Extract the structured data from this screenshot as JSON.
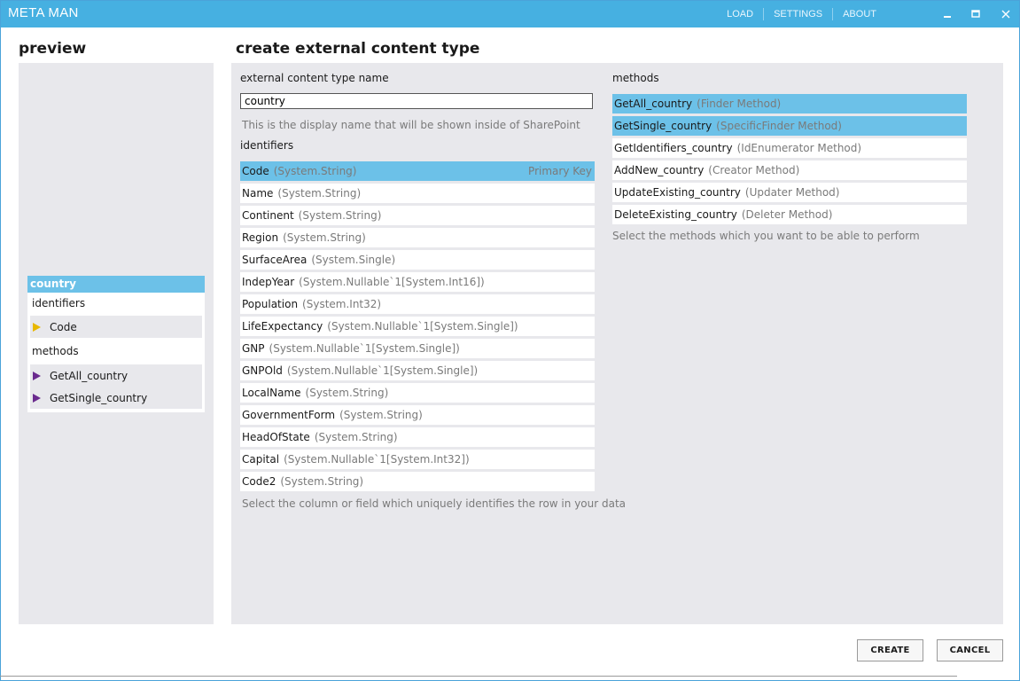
{
  "app": {
    "title": "META MAN"
  },
  "topnav": {
    "load": "LOAD",
    "settings": "SETTINGS",
    "about": "ABOUT"
  },
  "preview": {
    "heading": "preview",
    "card_title": "country",
    "identifiers_label": "identifiers",
    "identifiers": [
      "Code"
    ],
    "methods_label": "methods",
    "methods": [
      "GetAll_country",
      "GetSingle_country"
    ]
  },
  "main": {
    "heading": "create external content type",
    "name_label": "external content type name",
    "name_value": "country",
    "name_hint": "This is the display name that will be shown inside of SharePoint",
    "identifiers_label": "identifiers",
    "primary_key_label": "Primary Key",
    "identifiers_hint": "Select the column or field which uniquely identifies the row in your data",
    "fields": [
      {
        "name": "Code",
        "type": "(System.String)",
        "selected": true
      },
      {
        "name": "Name",
        "type": "(System.String)",
        "selected": false
      },
      {
        "name": "Continent",
        "type": "(System.String)",
        "selected": false
      },
      {
        "name": "Region",
        "type": "(System.String)",
        "selected": false
      },
      {
        "name": "SurfaceArea",
        "type": "(System.Single)",
        "selected": false
      },
      {
        "name": "IndepYear",
        "type": "(System.Nullable`1[System.Int16])",
        "selected": false
      },
      {
        "name": "Population",
        "type": "(System.Int32)",
        "selected": false
      },
      {
        "name": "LifeExpectancy",
        "type": "(System.Nullable`1[System.Single])",
        "selected": false
      },
      {
        "name": "GNP",
        "type": "(System.Nullable`1[System.Single])",
        "selected": false
      },
      {
        "name": "GNPOld",
        "type": "(System.Nullable`1[System.Single])",
        "selected": false
      },
      {
        "name": "LocalName",
        "type": "(System.String)",
        "selected": false
      },
      {
        "name": "GovernmentForm",
        "type": "(System.String)",
        "selected": false
      },
      {
        "name": "HeadOfState",
        "type": "(System.String)",
        "selected": false
      },
      {
        "name": "Capital",
        "type": "(System.Nullable`1[System.Int32])",
        "selected": false
      },
      {
        "name": "Code2",
        "type": "(System.String)",
        "selected": false
      }
    ],
    "methods_label": "methods",
    "methods": [
      {
        "name": "GetAll_country",
        "type": "(Finder Method)",
        "selected": true
      },
      {
        "name": "GetSingle_country",
        "type": "(SpecificFinder Method)",
        "selected": true
      },
      {
        "name": "GetIdentifiers_country",
        "type": "(IdEnumerator Method)",
        "selected": false
      },
      {
        "name": "AddNew_country",
        "type": "(Creator Method)",
        "selected": false
      },
      {
        "name": "UpdateExisting_country",
        "type": "(Updater Method)",
        "selected": false
      },
      {
        "name": "DeleteExisting_country",
        "type": "(Deleter Method)",
        "selected": false
      }
    ],
    "methods_hint": "Select the methods which you want to be able to perform"
  },
  "footer": {
    "create": "CREATE",
    "cancel": "CANCEL"
  },
  "colors": {
    "titlebar": "#46b0e1",
    "selection": "#6cc1e8",
    "panel": "#e8e8ec"
  }
}
